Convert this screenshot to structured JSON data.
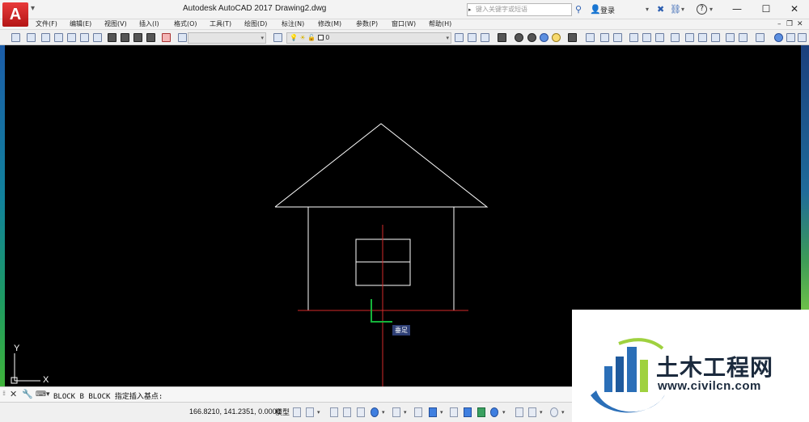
{
  "titlebar": {
    "app_logo": "A",
    "app_name": "Autodesk AutoCAD 2017",
    "document": "Drawing2.dwg",
    "search_placeholder": "键入关键字或短语",
    "login": "登录",
    "help": "?"
  },
  "menubar": {
    "items": [
      "文件(F)",
      "编辑(E)",
      "视图(V)",
      "插入(I)",
      "格式(O)",
      "工具(T)",
      "绘图(D)",
      "标注(N)",
      "修改(M)",
      "参数(P)",
      "窗口(W)",
      "帮助(H)"
    ]
  },
  "toolbar": {
    "layer_value": "0"
  },
  "canvas": {
    "ucs_y": "Y",
    "ucs_x": "X",
    "snap_tooltip": "垂足",
    "colors": {
      "geometry": "#ffffff",
      "cursor": "#d42a2a",
      "marker": "#15b33a"
    }
  },
  "command": {
    "text": "BLOCK B BLOCK 指定插入基点:"
  },
  "status": {
    "coordinates": "166.8210, 141.2351, 0.0000",
    "model": "模型"
  },
  "watermark": {
    "name": "土木工程网",
    "url": "www.civilcn.com"
  }
}
